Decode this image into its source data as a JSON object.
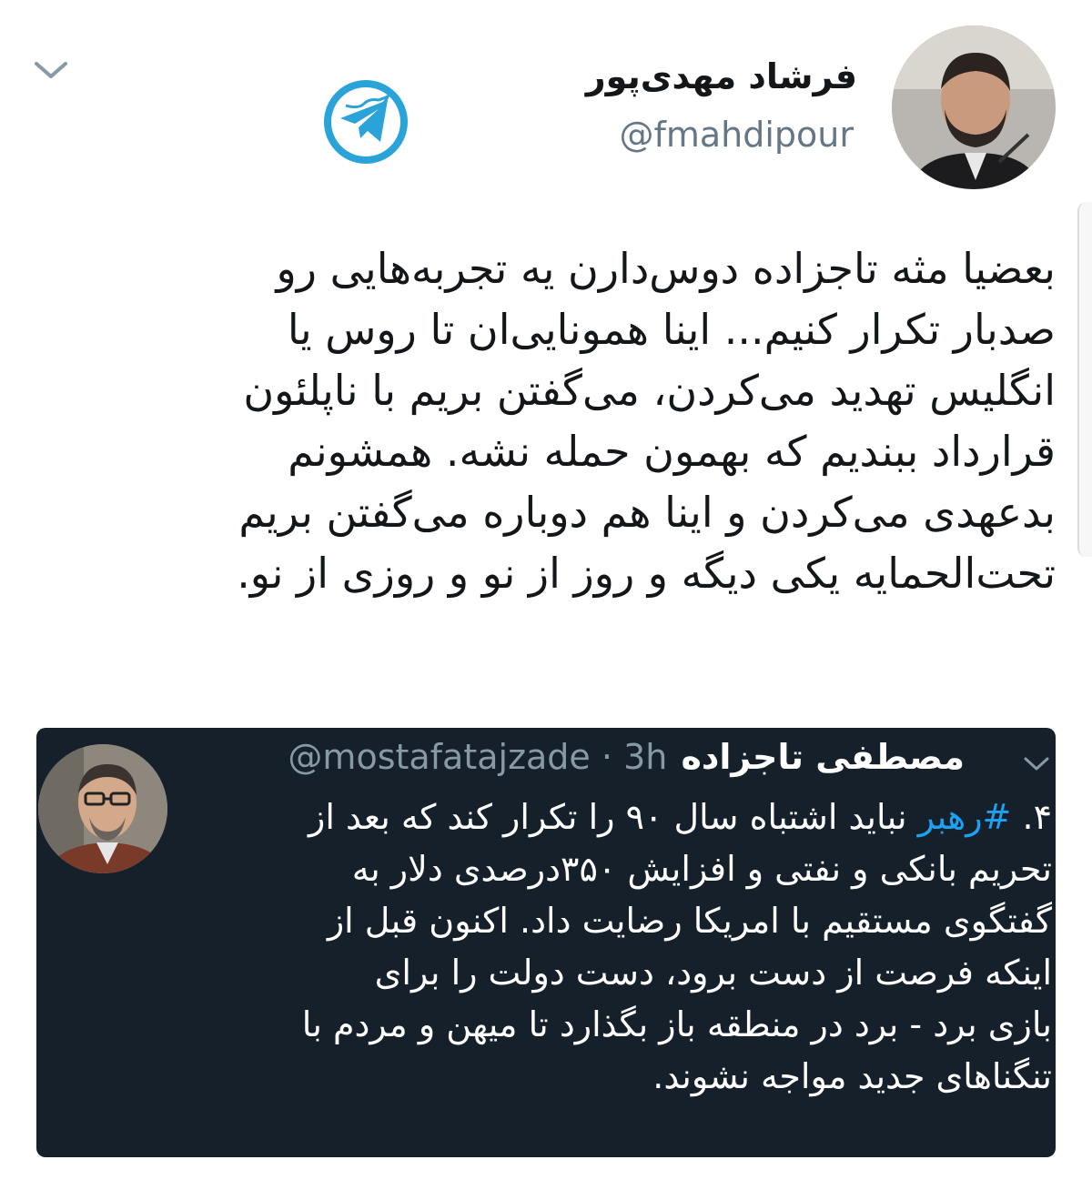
{
  "author": {
    "display_name": "فرشاد مهدی‌پور",
    "handle": "@fmahdipour"
  },
  "tweet": {
    "lines": [
      "بعضیا مثه تاجزاده دوس‌دارن یه تجربه‌هایی رو",
      "صدبار تکرار کنیم... اینا همونایی‌ان تا روس یا",
      "انگلیس تهدید می‌کردن، می‌گفتن بریم با ناپلئون",
      "قرارداد ببندیم که بهمون حمله نشه. همشونم",
      "بدعهدی می‌کردن و اینا هم دوباره می‌گفتن بریم",
      "تحت‌الحمایه یکی دیگه و روز از نو و روزی از نو."
    ]
  },
  "quoted_tweet": {
    "display_name": "مصطفی تاجزاده",
    "handle": "@mostafatajzade",
    "separator": "·",
    "time": "3h",
    "line1_prefix": "۴.",
    "line1_hashtag": "#رهبر",
    "line1_rest": "نباید اشتباه سال ۹۰ را تکرار کند که بعد از",
    "lines": [
      "تحریم بانکی و نفتی و افزایش ۳۵۰درصدی دلار به",
      "گفتگوی مستقیم با امریکا رضایت داد. اکنون قبل از",
      "اینکه فرصت از دست برود، دست دولت را برای",
      "بازی برد - برد در منطقه باز بگذارد تا میهن و مردم با",
      "تنگناهای جدید مواجه نشوند."
    ]
  },
  "icons": {
    "badge": "telegram-twitter-badge-icon",
    "caret": "chevron-down-icon"
  },
  "colors": {
    "text": "#14171a",
    "secondary": "#657786",
    "badge_blue": "#2aa3d9",
    "card_bg": "#15202b",
    "hashtag": "#1da1f2"
  }
}
